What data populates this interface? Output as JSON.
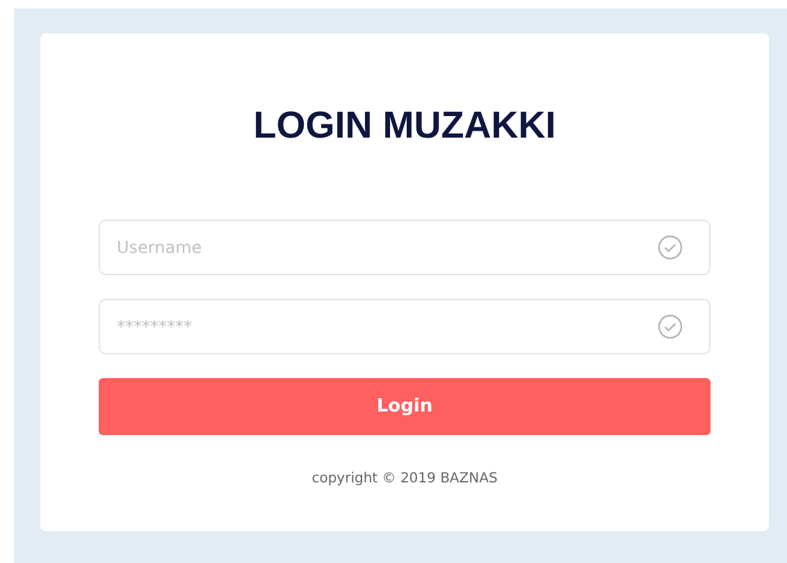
{
  "title": "LOGIN MUZAKKI",
  "fields": [
    {
      "placeholder": "Username"
    },
    {
      "placeholder": "*********"
    }
  ],
  "button": "Login",
  "footer": "copyright © 2019 BAZNAS"
}
